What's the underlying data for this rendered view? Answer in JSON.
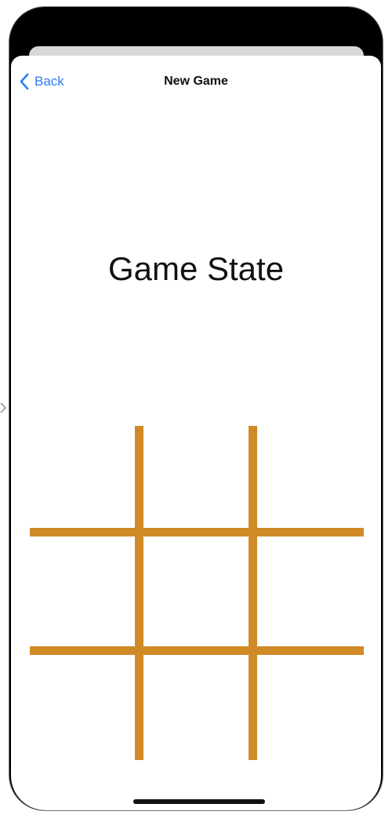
{
  "nav": {
    "back_label": "Back",
    "title": "New Game"
  },
  "main": {
    "game_state_label": "Game State"
  },
  "board": {
    "rows": 3,
    "cols": 3,
    "cells": [
      "",
      "",
      "",
      "",
      "",
      "",
      "",
      "",
      ""
    ]
  },
  "colors": {
    "accent": "#2f7cf6",
    "grid": "#d08a26",
    "device_frame": "#000000",
    "background": "#ffffff"
  },
  "icons": {
    "back": "chevron-left-icon",
    "connector": "arrow-right-icon"
  }
}
